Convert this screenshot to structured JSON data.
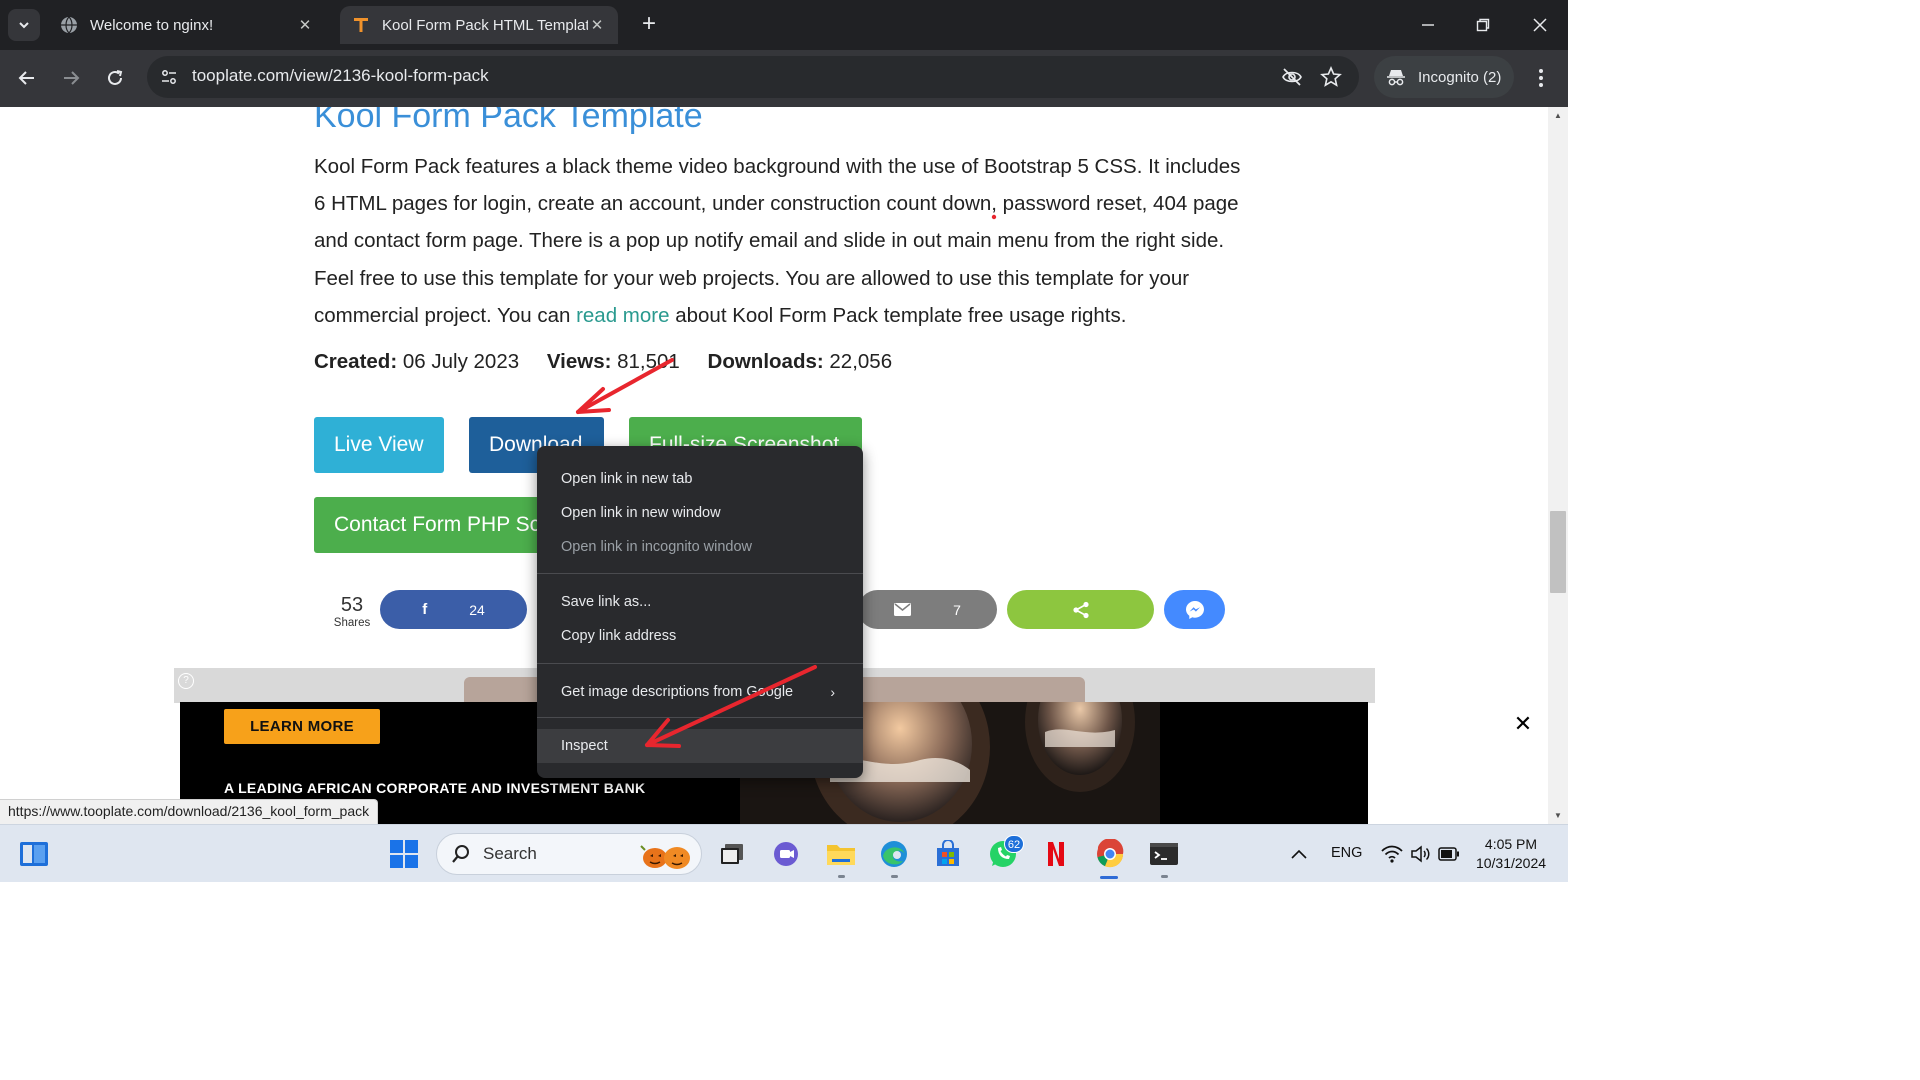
{
  "browser": {
    "tabs": [
      {
        "title": "Welcome to nginx!",
        "active": false,
        "icon": "globe-icon"
      },
      {
        "title": "Kool Form Pack HTML Template",
        "active": true,
        "icon": "tooplate-icon"
      }
    ],
    "url": "tooplate.com/view/2136-kool-form-pack",
    "incognito_label": "Incognito (2)",
    "status_url": "https://www.tooplate.com/download/2136_kool_form_pack"
  },
  "page": {
    "heading": "Kool Form Pack Template",
    "description_before": "Kool Form Pack features a black theme video background with the use of Bootstrap 5 CSS. It includes 6 HTML pages for login, create an account, under construction count down, password reset, 404 page and contact form page. There is a pop up notify email and slide in out main menu from the right side. Feel free to use this template for your web projects. You are allowed to use this template for your commercial project. You can ",
    "description_link": "read more",
    "description_after": " about Kool Form Pack template free usage rights.",
    "created_label": "Created:",
    "created_value": "06 July 2023",
    "views_label": "Views:",
    "views_value": "81,501",
    "downloads_label": "Downloads:",
    "downloads_value": "22,056",
    "buttons": {
      "live_view": "Live View",
      "download": "Download",
      "full_screenshot": "Full-size Screenshot",
      "contact_form": "Contact Form PHP Script"
    },
    "share": {
      "total": "53",
      "total_label": "Shares",
      "facebook_count": "24",
      "email_count": "7"
    }
  },
  "ad": {
    "cta": "LEARN MORE",
    "tagline": "A LEADING AFRICAN CORPORATE AND INVESTMENT BANK"
  },
  "context_menu": {
    "items": [
      {
        "label": "Open link in new tab",
        "enabled": true
      },
      {
        "label": "Open link in new window",
        "enabled": true
      },
      {
        "label": "Open link in incognito window",
        "enabled": false
      },
      {
        "label": "Save link as...",
        "enabled": true
      },
      {
        "label": "Copy link address",
        "enabled": true
      },
      {
        "label": "Get image descriptions from Google",
        "enabled": true,
        "submenu": true
      },
      {
        "label": "Inspect",
        "enabled": true,
        "highlighted": true
      }
    ]
  },
  "taskbar": {
    "search_placeholder": "Search",
    "whatsapp_badge": "62",
    "language": "ENG",
    "time": "4:05 PM",
    "date": "10/31/2024"
  },
  "colors": {
    "annotation_arrow": "#e8262e",
    "heading": "#3a8fd8",
    "link": "#2a9a8f"
  }
}
